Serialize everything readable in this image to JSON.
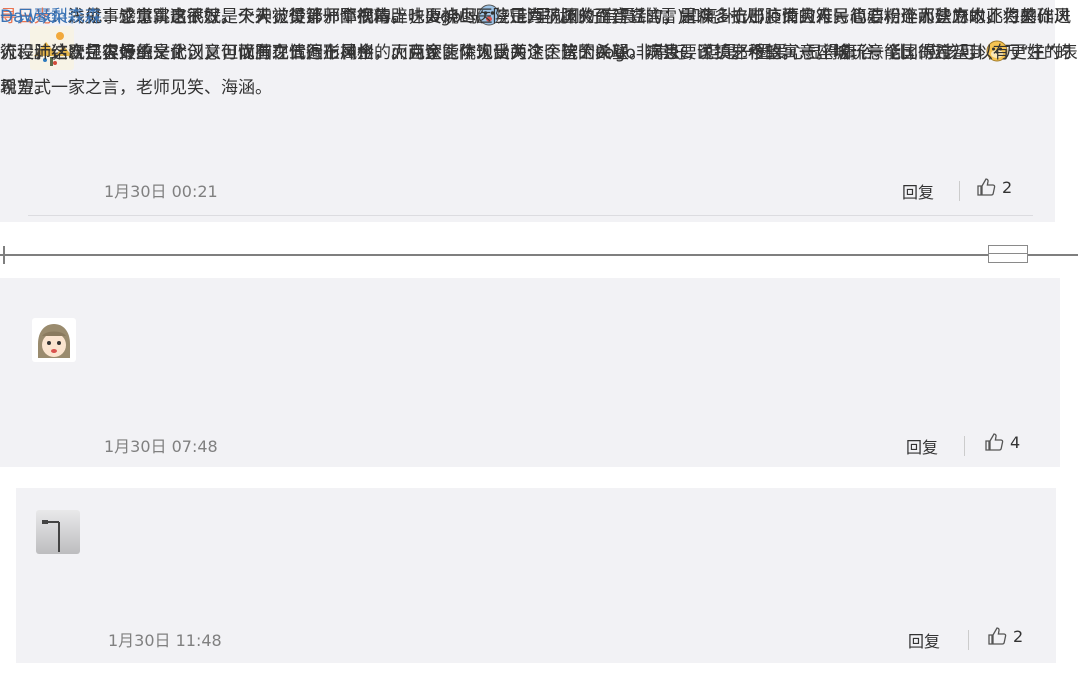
{
  "comments": [
    {
      "username": "寻日光",
      "colon": "：",
      "text": "浅见：立意跳出武汉。火神，焚那邪障病毒，也要烧尽那些正真祸国的歪音谣言；雷神，击那疫情灾难，也要粉碎那些麻木不仁的作风流程。这次扛灾最重是武汉，但忧国之情遍布神州的。两家医院饱受关注，皆因希望。病患、医护之希望，一座城、一个国的希望，亿万“生”的希望。一家之言，老师见笑、海涵。",
      "timestamp": "1月30日 00:21",
      "reply_label": "回复",
      "likes": "2",
      "avatar_icon": "landscape-avatar-icon"
    },
    {
      "username": "一只琴梨",
      "colon": "：",
      "text_part1": "就事论事，这不就是天天被设计师鄙视的土味logo吗",
      "text_part2": "八卦里就刚好有震卦(雷)和离卦(火)，而且符号简洁，个人认为以此为基础进行设计，既包容传统文化，又可以有现代图形风格，而且还能体现出两个医院的关联。况且要说镇邪秽的寓意，啥玩意能比得过八卦",
      "timestamp": "1月30日 07:48",
      "reply_label": "回复",
      "likes": "4",
      "avatar_icon": "cartoon-girl-avatar-icon",
      "emoji_1": "crying-face-emoji",
      "emoji_2": "doge-emoji"
    },
    {
      "username": "Dawson森森",
      "colon": "：",
      "text": "感觉寓意很好，个人觉得第一个很精辟，火神山医院是为了肺炎而建立的，是众多抗击肺炎的人民心心相连而建立的，将火、人、肺结合是很好的一个创意，而肺在五行上属金，火克金，个人认为这个这个Logo非常好，但是一圈爱心显得庸俗，乱，应该可以有更好的表现方式",
      "timestamp": "1月30日 11:48",
      "reply_label": "回复",
      "likes": "2",
      "avatar_icon": "street-lamp-avatar-icon"
    }
  ],
  "colors": {
    "username_orange": "#eb7350",
    "username_blue": "#3a73b5",
    "panel_bg": "#f2f2f5",
    "meta_gray": "#808080"
  }
}
